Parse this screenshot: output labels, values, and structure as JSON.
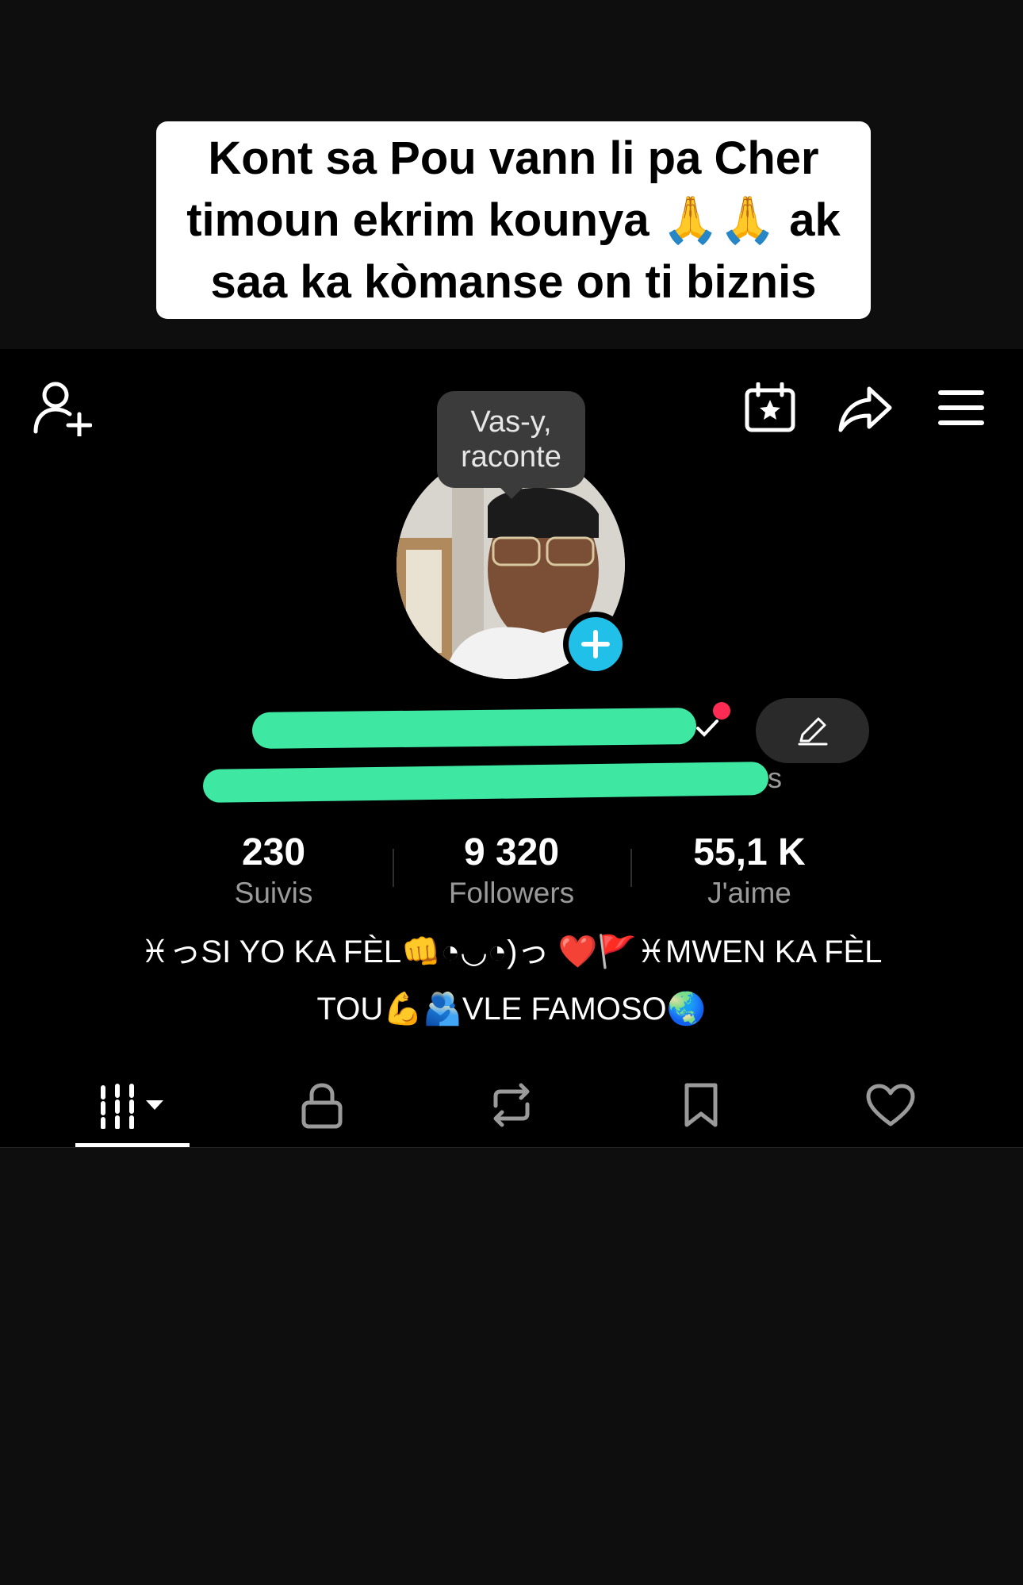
{
  "caption": {
    "line1": "Kont sa Pou vann li pa Cher",
    "line2": "timoun ekrim kounya 🙏🙏 ak",
    "line3": "saa ka kòmanse on ti biznis"
  },
  "header": {
    "add_friend_icon": "person-plus-icon",
    "calendar_icon": "calendar-star-icon",
    "share_icon": "share-arrow-icon",
    "menu_icon": "hamburger-menu-icon"
  },
  "tooltip": {
    "line1": "Vas-y,",
    "line2": "raconte"
  },
  "handle_suffix": "s",
  "stats": [
    {
      "value": "230",
      "label": "Suivis"
    },
    {
      "value": "9 320",
      "label": "Followers"
    },
    {
      "value": "55,1 K",
      "label": "J'aime"
    }
  ],
  "bio": {
    "line1": "♓っSI YO KA FÈL👊◔◡◔)っ ❤️🚩♓MWEN KA FÈL",
    "line2": "TOU💪🫂VLE FAMOSO🌏"
  },
  "tabs": [
    {
      "icon": "grid-videos-icon",
      "active": true
    },
    {
      "icon": "lock-icon"
    },
    {
      "icon": "repost-icon"
    },
    {
      "icon": "bookmark-icon"
    },
    {
      "icon": "heart-icon"
    }
  ],
  "colors": {
    "accent_blue": "#20c0e8",
    "notification_red": "#fe2c55",
    "scribble_green": "#3ee8a2"
  }
}
